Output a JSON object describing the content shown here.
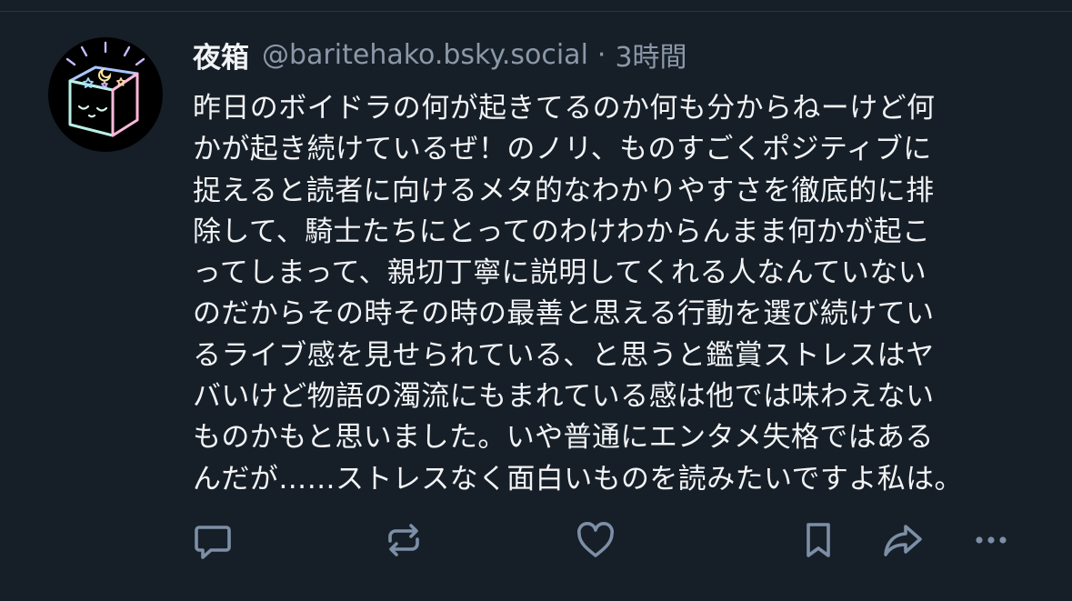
{
  "post": {
    "author": {
      "display_name": "夜箱",
      "handle": "@baritehako.bsky.social"
    },
    "separator": "·",
    "timestamp": "3時間",
    "text": "昨日のボイドラの何が起きてるのか何も分からねーけど何\nかが起き続けているぜ！のノリ、ものすごくポジティブに\n捉えると読者に向けるメタ的なわかりやすさを徹底的に排\n除して、騎士たちにとってのわけわからんまま何かが起こ\nってしまって、親切丁寧に説明してくれる人なんていない\nのだからその時その時の最善と思える行動を選び続けてい\nるライブ感を見せられている、と思うと鑑賞ストレスはヤ\nバいけど物語の濁流にもまれている感は他では味わえない\nものかもと思いました。いや普通にエンタメ失格ではある\nんだが……ストレスなく面白いものを読みたいですよ私は。"
  },
  "actions": [
    {
      "name": "reply",
      "icon": "reply-icon"
    },
    {
      "name": "repost",
      "icon": "repost-icon"
    },
    {
      "name": "like",
      "icon": "heart-icon"
    },
    {
      "name": "bookmark",
      "icon": "bookmark-icon"
    },
    {
      "name": "share",
      "icon": "share-icon"
    },
    {
      "name": "more",
      "icon": "more-icon"
    }
  ],
  "colors": {
    "background": "#161e27",
    "text": "#f1f3f5",
    "muted": "#8b98a8",
    "icon": "#7c8fa6"
  }
}
